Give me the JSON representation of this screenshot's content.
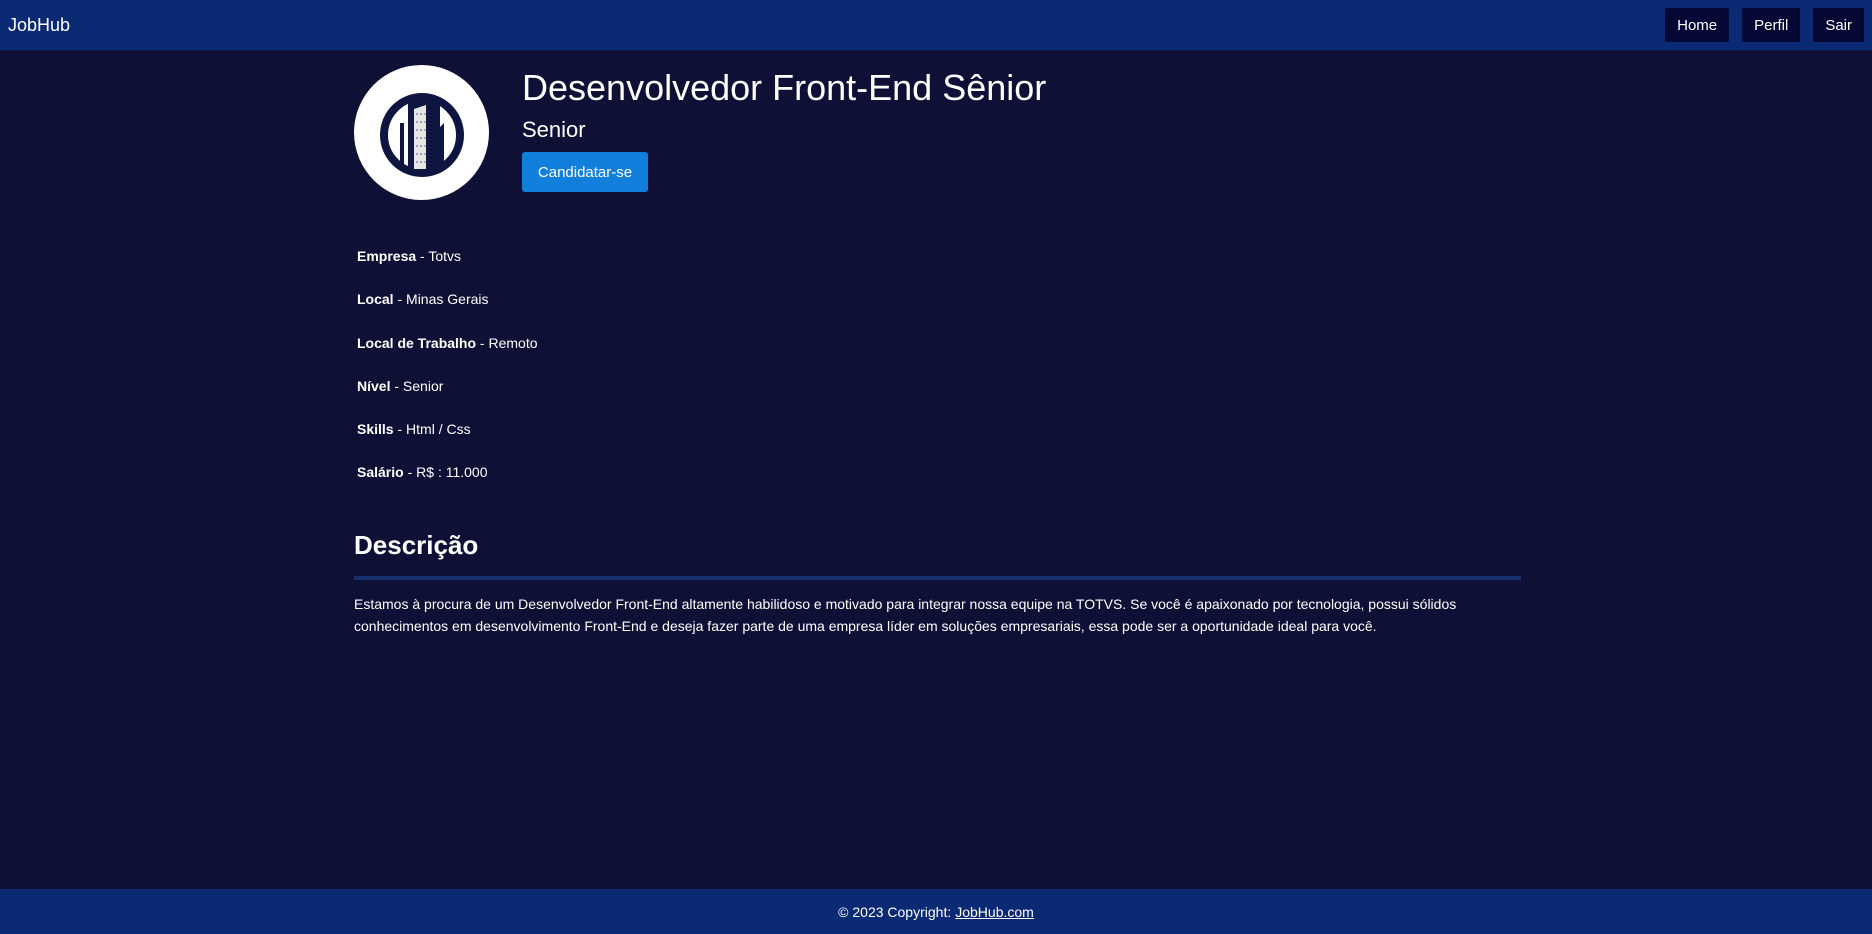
{
  "navbar": {
    "brand": "JobHub",
    "links": [
      {
        "label": "Home"
      },
      {
        "label": "Perfil"
      },
      {
        "label": "Sair"
      }
    ]
  },
  "job": {
    "title": "Desenvolvedor Front-End Sênior",
    "level": "Senior",
    "apply_label": "Candidatar-se",
    "logo_icon": "building-icon",
    "details": [
      {
        "label": "Empresa",
        "value": "Totvs"
      },
      {
        "label": "Local",
        "value": "Minas Gerais"
      },
      {
        "label": "Local de Trabalho",
        "value": "Remoto"
      },
      {
        "label": "Nível",
        "value": "Senior"
      },
      {
        "label": "Skills",
        "value": "Html / Css"
      },
      {
        "label": "Salário",
        "value": "R$ : 11.000"
      }
    ],
    "separator": " - ",
    "description_title": "Descrição",
    "description": "Estamos à procura de um Desenvolvedor Front-End altamente habilidoso e motivado para integrar nossa equipe na TOTVS. Se você é apaixonado por tecnologia, possui sólidos conhecimentos em desenvolvimento Front-End e deseja fazer parte de uma empresa líder em soluções empresariais, essa pode ser a oportunidade ideal para você."
  },
  "footer": {
    "copyright": "© 2023 Copyright:",
    "link": "JobHub.com"
  },
  "colors": {
    "background": "#0e1035",
    "navbar": "#0a2a73",
    "nav_button": "#050735",
    "accent": "#137fdd"
  }
}
